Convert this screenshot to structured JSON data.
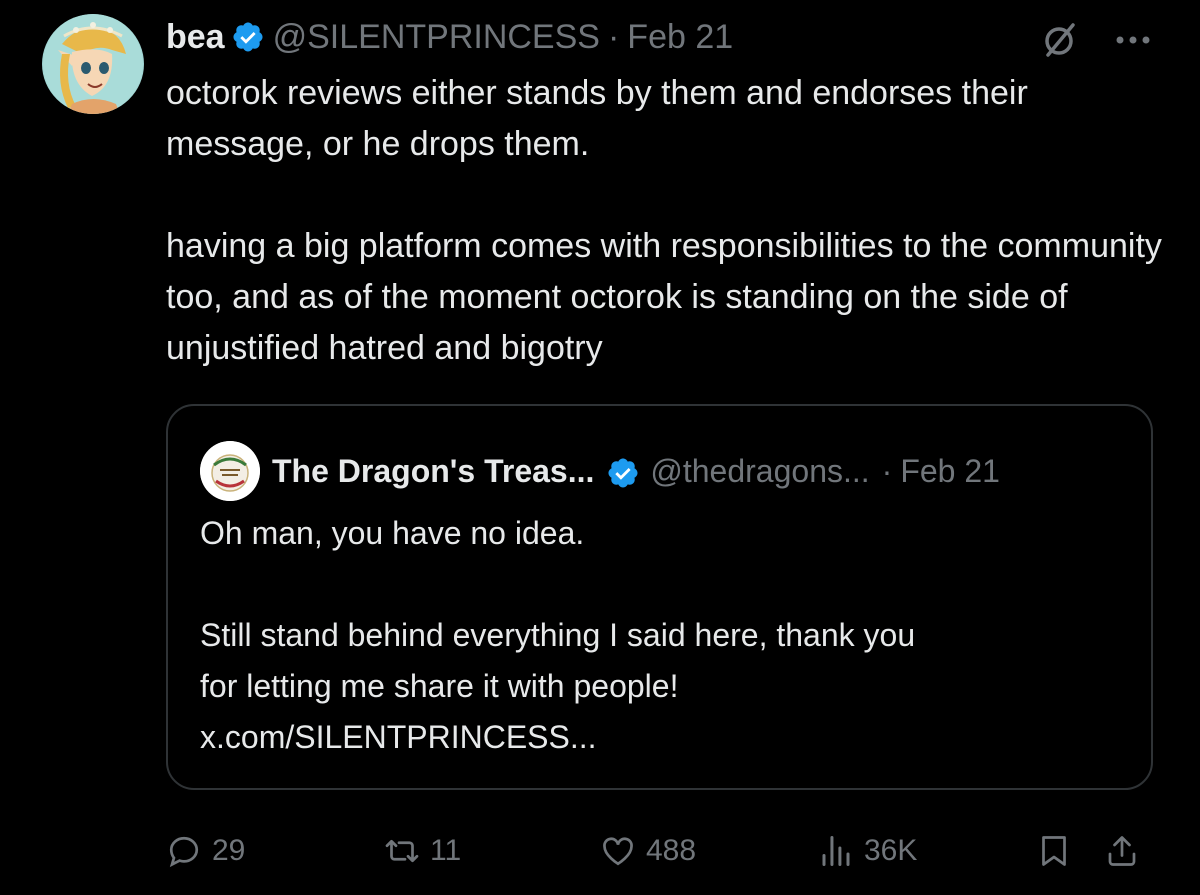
{
  "author": {
    "name": "bea",
    "handle": "@SILENTPRINCESS",
    "separator": "·",
    "date": "Feb 21",
    "verified": true
  },
  "tweet_text": {
    "paragraph_1": "octorok reviews either stands by them and endorses their message, or he drops them.",
    "paragraph_2": "having a big platform comes with responsibilities to the community too, and as of the moment octorok is standing on the side of unjustified hatred and bigotry"
  },
  "quoted_tweet": {
    "name": "The Dragon's Treas...",
    "handle": "@thedragons...",
    "separator": "·",
    "date": "Feb 21",
    "verified": true,
    "paragraph_1": "Oh man, you have no idea.",
    "paragraph_2_line_1": "Still stand behind everything I said here, thank you",
    "paragraph_2_line_2": "for letting me share it with people!",
    "link": "x.com/SILENTPRINCESS..."
  },
  "actions": {
    "replies": "29",
    "reposts": "11",
    "likes": "488",
    "views": "36K"
  },
  "colors": {
    "background": "#000000",
    "text": "#e7e9ea",
    "secondary": "#71767b",
    "verified_badge": "#1d9bf0",
    "border": "#2f3336"
  },
  "icons": [
    "verified-badge-icon",
    "grok-icon",
    "more-icon",
    "reply-icon",
    "repost-icon",
    "like-icon",
    "views-icon",
    "bookmark-icon",
    "share-icon"
  ]
}
